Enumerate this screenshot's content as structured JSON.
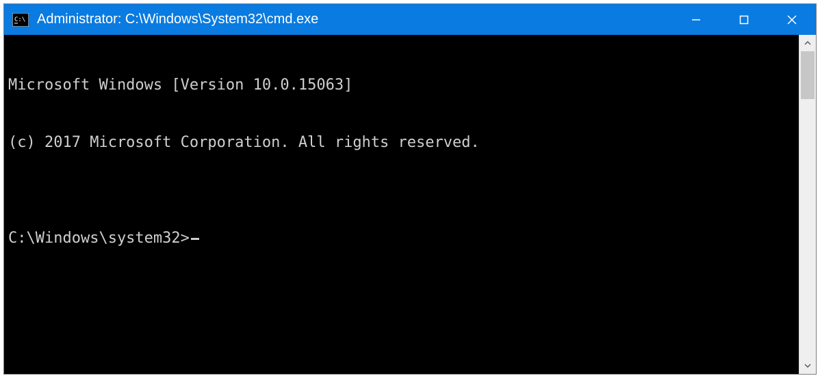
{
  "window": {
    "title": "Administrator: C:\\Windows\\System32\\cmd.exe"
  },
  "terminal": {
    "line1": "Microsoft Windows [Version 10.0.15063]",
    "line2": "(c) 2017 Microsoft Corporation. All rights reserved.",
    "blank": "",
    "prompt": "C:\\Windows\\system32>"
  },
  "colors": {
    "titlebar": "#0a7be0",
    "terminal_bg": "#000000",
    "terminal_fg": "#cfcfcf"
  }
}
